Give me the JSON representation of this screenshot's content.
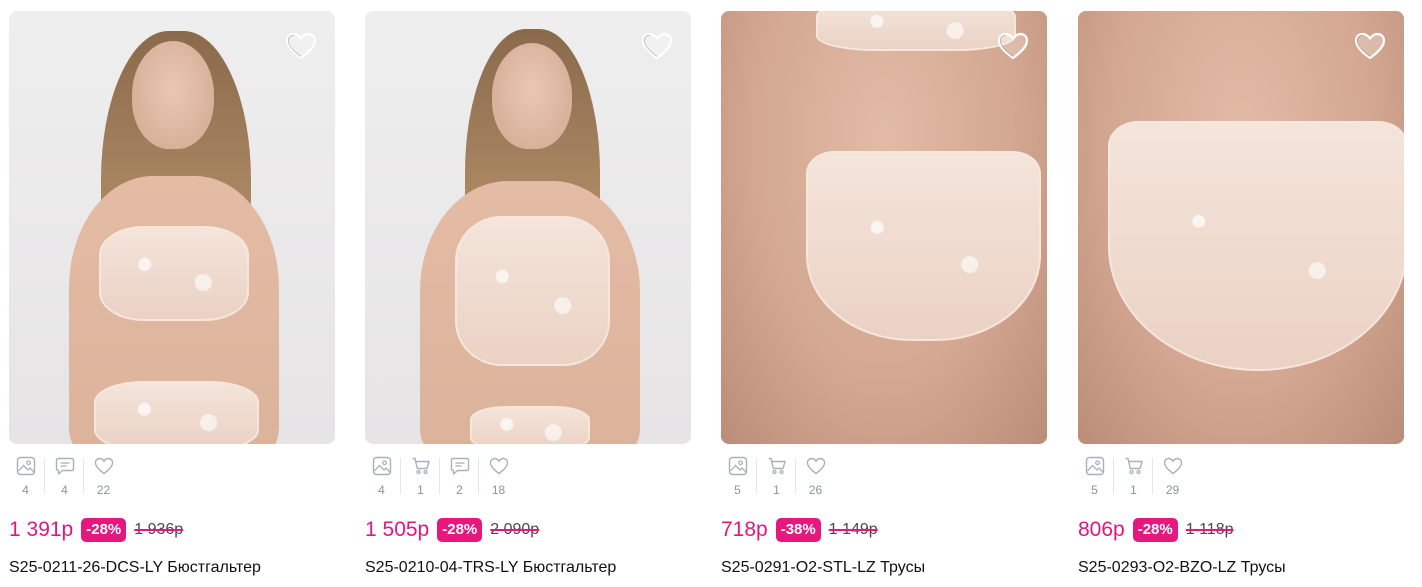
{
  "colors": {
    "accent": "#e6187f",
    "price": "#e0177f",
    "muted": "#8a93a0"
  },
  "products": [
    {
      "photos": "4",
      "reviews": "4",
      "likes": "22",
      "price": "1 391р",
      "discount": "-28%",
      "old_price": "1 936р",
      "title": "S25-0211-26-DCS-LY Бюстгальтер"
    },
    {
      "photos": "4",
      "cart": "1",
      "reviews": "2",
      "likes": "18",
      "price": "1 505р",
      "discount": "-28%",
      "old_price": "2 090р",
      "title": "S25-0210-04-TRS-LY Бюстгальтер"
    },
    {
      "photos": "5",
      "cart": "1",
      "likes": "26",
      "price": "718р",
      "discount": "-38%",
      "old_price": "1 149р",
      "title": "S25-0291-O2-STL-LZ Трусы"
    },
    {
      "photos": "5",
      "cart": "1",
      "likes": "29",
      "price": "806р",
      "discount": "-28%",
      "old_price": "1 118р",
      "title": "S25-0293-O2-BZO-LZ Трусы"
    }
  ],
  "icons": {
    "favorite": "heart-outline-icon",
    "photos": "image-icon",
    "cart": "cart-icon",
    "reviews": "comment-icon",
    "likes": "heart-small-icon"
  }
}
